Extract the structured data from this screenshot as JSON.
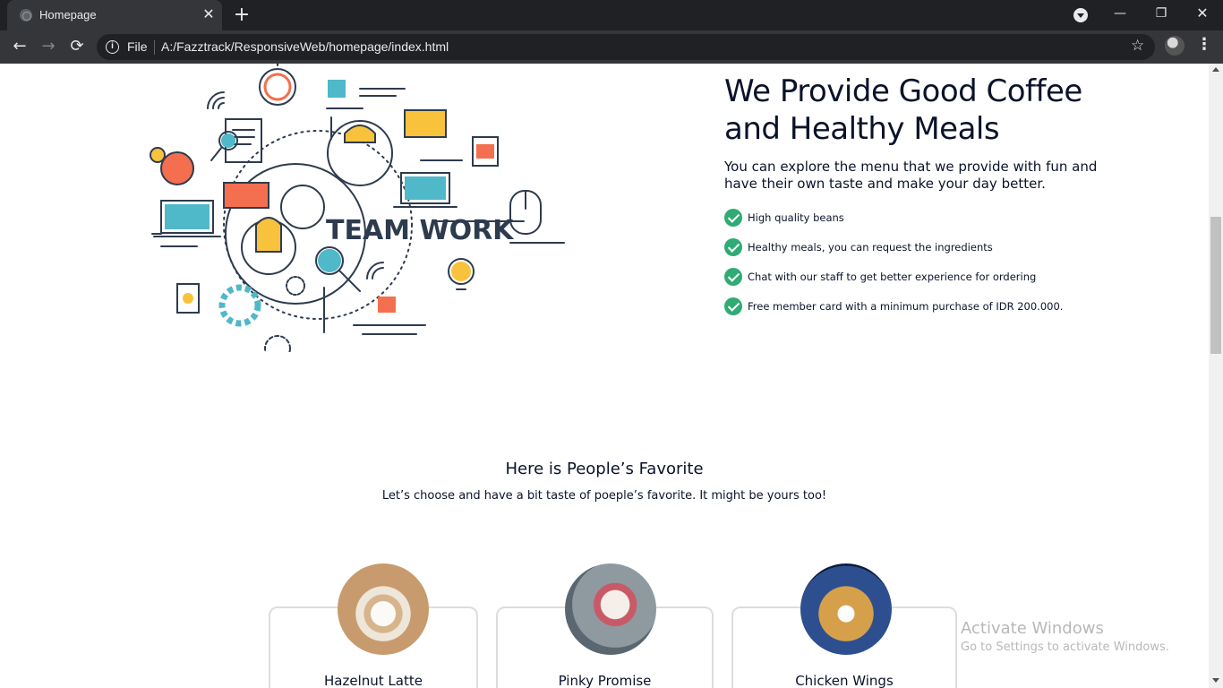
{
  "browser": {
    "tab_title": "Homepage",
    "tab_close": "✕",
    "new_tab": "+",
    "scheme_label": "File",
    "url": "A:/Fazztrack/ResponsiveWeb/homepage/index.html",
    "window_min": "—",
    "window_max": "❐",
    "window_close": "✕"
  },
  "hero": {
    "illustration_text": "TEAM WORK",
    "title": "We Provide Good Coffee and Healthy Meals",
    "description": "You can explore the menu that we provide with fun and have their own taste and make your day better.",
    "features": [
      "High quality beans",
      "Healthy meals, you can request the ingredients",
      "Chat with our staff to get better experience for ordering",
      "Free member card with a minimum purchase of IDR 200.000."
    ]
  },
  "favorites": {
    "title": "Here is People’s Favorite",
    "subtitle": "Let’s choose and have a bit taste of poeple’s favorite. It might be yours too!",
    "items": [
      {
        "name": "Hazelnut Latte"
      },
      {
        "name": "Pinky Promise"
      },
      {
        "name": "Chicken Wings"
      }
    ]
  },
  "watermark": {
    "line1": "Activate Windows",
    "line2": "Go to Settings to activate Windows."
  },
  "colors": {
    "check": "#2fab73",
    "heading": "#0b132a",
    "accent_orange": "#f36f4f",
    "accent_yellow": "#f9c23c",
    "accent_teal": "#4fb8c9",
    "illus_dark": "#2e3b4e"
  }
}
